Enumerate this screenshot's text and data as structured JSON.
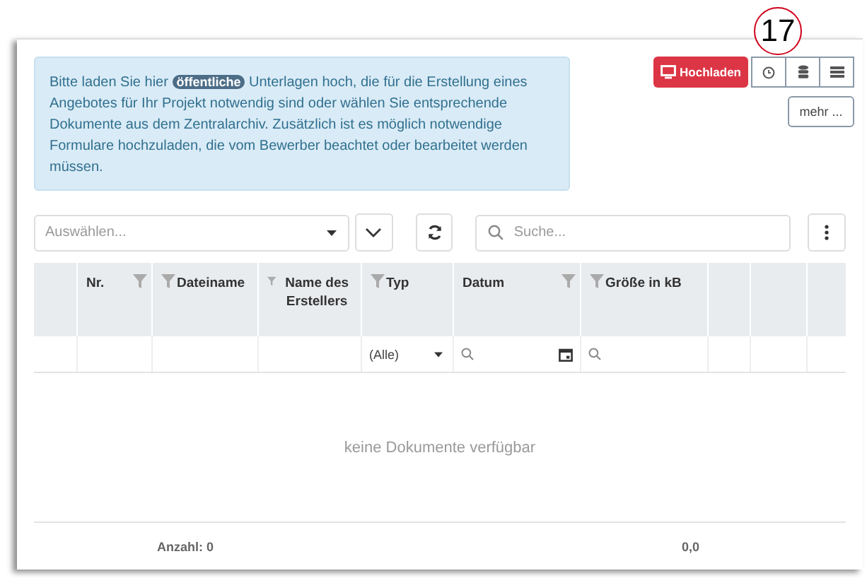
{
  "callout": {
    "number": "17"
  },
  "info": {
    "text_before": "Bitte laden Sie hier",
    "badge": "öffentliche",
    "text_after": "Unterlagen hoch, die für die Erstellung eines Angebotes für Ihr Projekt notwendig sind oder wählen Sie entsprechende Dokumente aus dem Zentralarchiv. Zusätzlich ist es möglich notwendige Formulare hochzuladen, die vom Bewerber beachtet oder bearbeitet werden müssen."
  },
  "upload_button": "Hochladen",
  "view_buttons": [
    {
      "kind": "clock"
    },
    {
      "kind": "stack"
    },
    {
      "kind": "list"
    }
  ],
  "more_button": "mehr ...",
  "toolbar": {
    "select_placeholder": "Auswählen...",
    "search_placeholder": "Suche..."
  },
  "table": {
    "columns": [
      {
        "kind": "plain"
      },
      {
        "label": "Nr.",
        "kind": "right"
      },
      {
        "label": "Dateiname",
        "kind": "left"
      },
      {
        "label": "Name des Erstellers",
        "kind": "left"
      },
      {
        "label": "Typ",
        "kind": "left"
      },
      {
        "label": "Datum",
        "kind": "right"
      },
      {
        "label": "Größe in kB",
        "kind": "left"
      },
      {
        "kind": "plain"
      },
      {
        "kind": "plain"
      },
      {
        "kind": "plain"
      }
    ],
    "filter_row": [
      {
        "kind": "empty"
      },
      {
        "kind": "empty"
      },
      {
        "kind": "empty"
      },
      {
        "kind": "empty"
      },
      {
        "kind": "select",
        "value": "(Alle)"
      },
      {
        "kind": "date"
      },
      {
        "kind": "search"
      },
      {
        "kind": "empty"
      },
      {
        "kind": "empty"
      },
      {
        "kind": "empty"
      }
    ],
    "empty_message": "keine Dokumente verfügbar",
    "footer": {
      "count": "Anzahl: 0",
      "size_total": "0,0"
    }
  }
}
